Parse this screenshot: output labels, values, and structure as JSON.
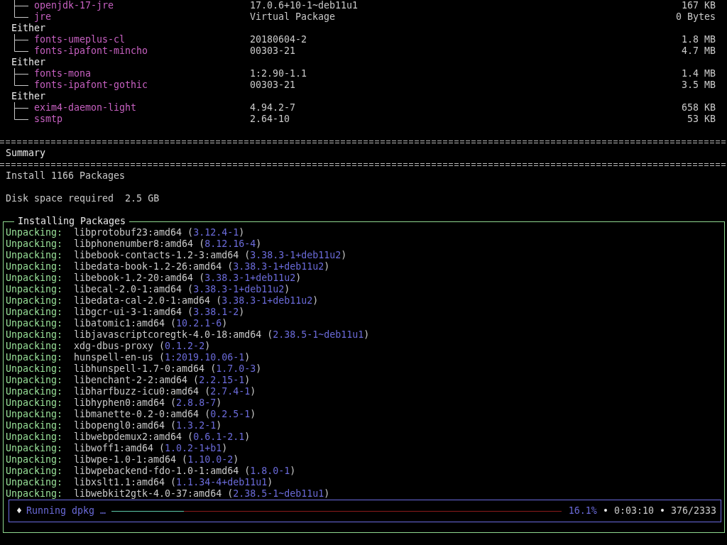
{
  "dependency_groups": [
    {
      "children": [
        {
          "name": "openjdk-17-jre",
          "version": "17.0.6+10-1~deb11u1",
          "size": "167 KB"
        },
        {
          "name": "jre",
          "version": "Virtual Package",
          "size": "0 Bytes"
        }
      ]
    },
    {
      "label": "Either",
      "children": [
        {
          "name": "fonts-umeplus-cl",
          "version": "20180604-2",
          "size": "1.8 MB"
        },
        {
          "name": "fonts-ipafont-mincho",
          "version": "00303-21",
          "size": "4.7 MB"
        }
      ]
    },
    {
      "label": "Either",
      "children": [
        {
          "name": "fonts-mona",
          "version": "1:2.90-1.1",
          "size": "1.4 MB"
        },
        {
          "name": "fonts-ipafont-gothic",
          "version": "00303-21",
          "size": "3.5 MB"
        }
      ]
    },
    {
      "label": "Either",
      "children": [
        {
          "name": "exim4-daemon-light",
          "version": "4.94.2-7",
          "size": "658 KB"
        },
        {
          "name": "ssmtp",
          "version": "2.64-10",
          "size": "53 KB"
        }
      ]
    }
  ],
  "summary": {
    "title": "Summary",
    "install": "Install 1166 Packages",
    "disk_label": "Disk space required",
    "disk_value": "2.5 GB"
  },
  "install_panel": {
    "title": "Installing Packages",
    "entries": [
      {
        "action": "Unpacking:",
        "package": "libprotobuf23:amd64",
        "version": "(3.12.4-1)"
      },
      {
        "action": "Unpacking:",
        "package": "libphonenumber8:amd64",
        "version": "(8.12.16-4)"
      },
      {
        "action": "Unpacking:",
        "package": "libebook-contacts-1.2-3:amd64",
        "version": "(3.38.3-1+deb11u2)"
      },
      {
        "action": "Unpacking:",
        "package": "libedata-book-1.2-26:amd64",
        "version": "(3.38.3-1+deb11u2)"
      },
      {
        "action": "Unpacking:",
        "package": "libebook-1.2-20:amd64",
        "version": "(3.38.3-1+deb11u2)"
      },
      {
        "action": "Unpacking:",
        "package": "libecal-2.0-1:amd64",
        "version": "(3.38.3-1+deb11u2)"
      },
      {
        "action": "Unpacking:",
        "package": "libedata-cal-2.0-1:amd64",
        "version": "(3.38.3-1+deb11u2)"
      },
      {
        "action": "Unpacking:",
        "package": "libgcr-ui-3-1:amd64",
        "version": "(3.38.1-2)"
      },
      {
        "action": "Unpacking:",
        "package": "libatomic1:amd64",
        "version": "(10.2.1-6)"
      },
      {
        "action": "Unpacking:",
        "package": "libjavascriptcoregtk-4.0-18:amd64",
        "version": "(2.38.5-1~deb11u1)"
      },
      {
        "action": "Unpacking:",
        "package": "xdg-dbus-proxy",
        "version": "(0.1.2-2)"
      },
      {
        "action": "Unpacking:",
        "package": "hunspell-en-us",
        "version": "(1:2019.10.06-1)"
      },
      {
        "action": "Unpacking:",
        "package": "libhunspell-1.7-0:amd64",
        "version": "(1.7.0-3)"
      },
      {
        "action": "Unpacking:",
        "package": "libenchant-2-2:amd64",
        "version": "(2.2.15-1)"
      },
      {
        "action": "Unpacking:",
        "package": "libharfbuzz-icu0:amd64",
        "version": "(2.7.4-1)"
      },
      {
        "action": "Unpacking:",
        "package": "libhyphen0:amd64",
        "version": "(2.8.8-7)"
      },
      {
        "action": "Unpacking:",
        "package": "libmanette-0.2-0:amd64",
        "version": "(0.2.5-1)"
      },
      {
        "action": "Unpacking:",
        "package": "libopengl0:amd64",
        "version": "(1.3.2-1)"
      },
      {
        "action": "Unpacking:",
        "package": "libwebpdemux2:amd64",
        "version": "(0.6.1-2.1)"
      },
      {
        "action": "Unpacking:",
        "package": "libwoff1:amd64",
        "version": "(1.0.2-1+b1)"
      },
      {
        "action": "Unpacking:",
        "package": "libwpe-1.0-1:amd64",
        "version": "(1.10.0-2)"
      },
      {
        "action": "Unpacking:",
        "package": "libwpebackend-fdo-1.0-1:amd64",
        "version": "(1.8.0-1)"
      },
      {
        "action": "Unpacking:",
        "package": "libxslt1.1:amd64",
        "version": "(1.1.34-4+deb11u1)"
      },
      {
        "action": "Unpacking:",
        "package": "libwebkit2gtk-4.0-37:amd64",
        "version": "(2.38.5-1~deb11u1)"
      }
    ]
  },
  "progress": {
    "spinner": "♦",
    "status": "Running dpkg …",
    "level": 0.161,
    "percent": "16.1%",
    "separator_1": "•",
    "elapsed": "0:03:10",
    "separator_2": "•",
    "count": "376/2333"
  }
}
